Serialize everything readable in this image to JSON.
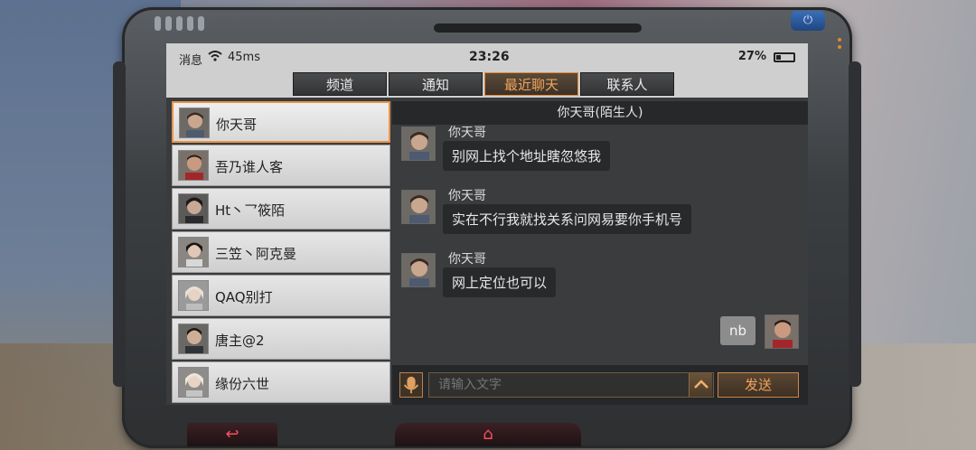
{
  "status_bar": {
    "notification_label": "消息",
    "ping": "45ms",
    "time": "23:26",
    "battery": "27%"
  },
  "tabs": [
    {
      "label": "频道",
      "active": false
    },
    {
      "label": "通知",
      "active": false
    },
    {
      "label": "最近聊天",
      "active": true
    },
    {
      "label": "联系人",
      "active": false
    }
  ],
  "contacts": [
    {
      "name": "你天哥",
      "selected": true
    },
    {
      "name": "吾乃谁人客",
      "selected": false
    },
    {
      "name": "Ht丶乛筱陌",
      "selected": false
    },
    {
      "name": "三笠丶阿克曼",
      "selected": false
    },
    {
      "name": "QAQ别打",
      "selected": false
    },
    {
      "name": "唐主@2",
      "selected": false
    },
    {
      "name": "缘份六世",
      "selected": false
    }
  ],
  "chat": {
    "header": "你天哥(陌生人)",
    "messages": [
      {
        "sender": "你天哥",
        "text": "别网上找个地址瞎忽悠我"
      },
      {
        "sender": "你天哥",
        "text": "实在不行我就找关系问网易要你手机号"
      },
      {
        "sender": "你天哥",
        "text": "网上定位也可以"
      }
    ],
    "my_message": "nb",
    "input_placeholder": "请输入文字",
    "send_label": "发送"
  },
  "colors": {
    "accent": "#e89448",
    "home_button": "#ff4d5e",
    "power_button": "#2d5da0"
  }
}
